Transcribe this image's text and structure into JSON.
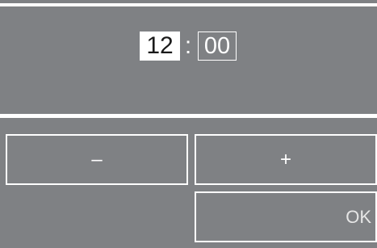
{
  "time": {
    "hours": "12",
    "separator": ":",
    "minutes": "00"
  },
  "buttons": {
    "decrement_label": "–",
    "increment_label": "+",
    "ok_label": "OK"
  },
  "colors": {
    "background": "#7f8184",
    "foreground": "#ffffff",
    "selected_text": "#1a1a1a"
  }
}
